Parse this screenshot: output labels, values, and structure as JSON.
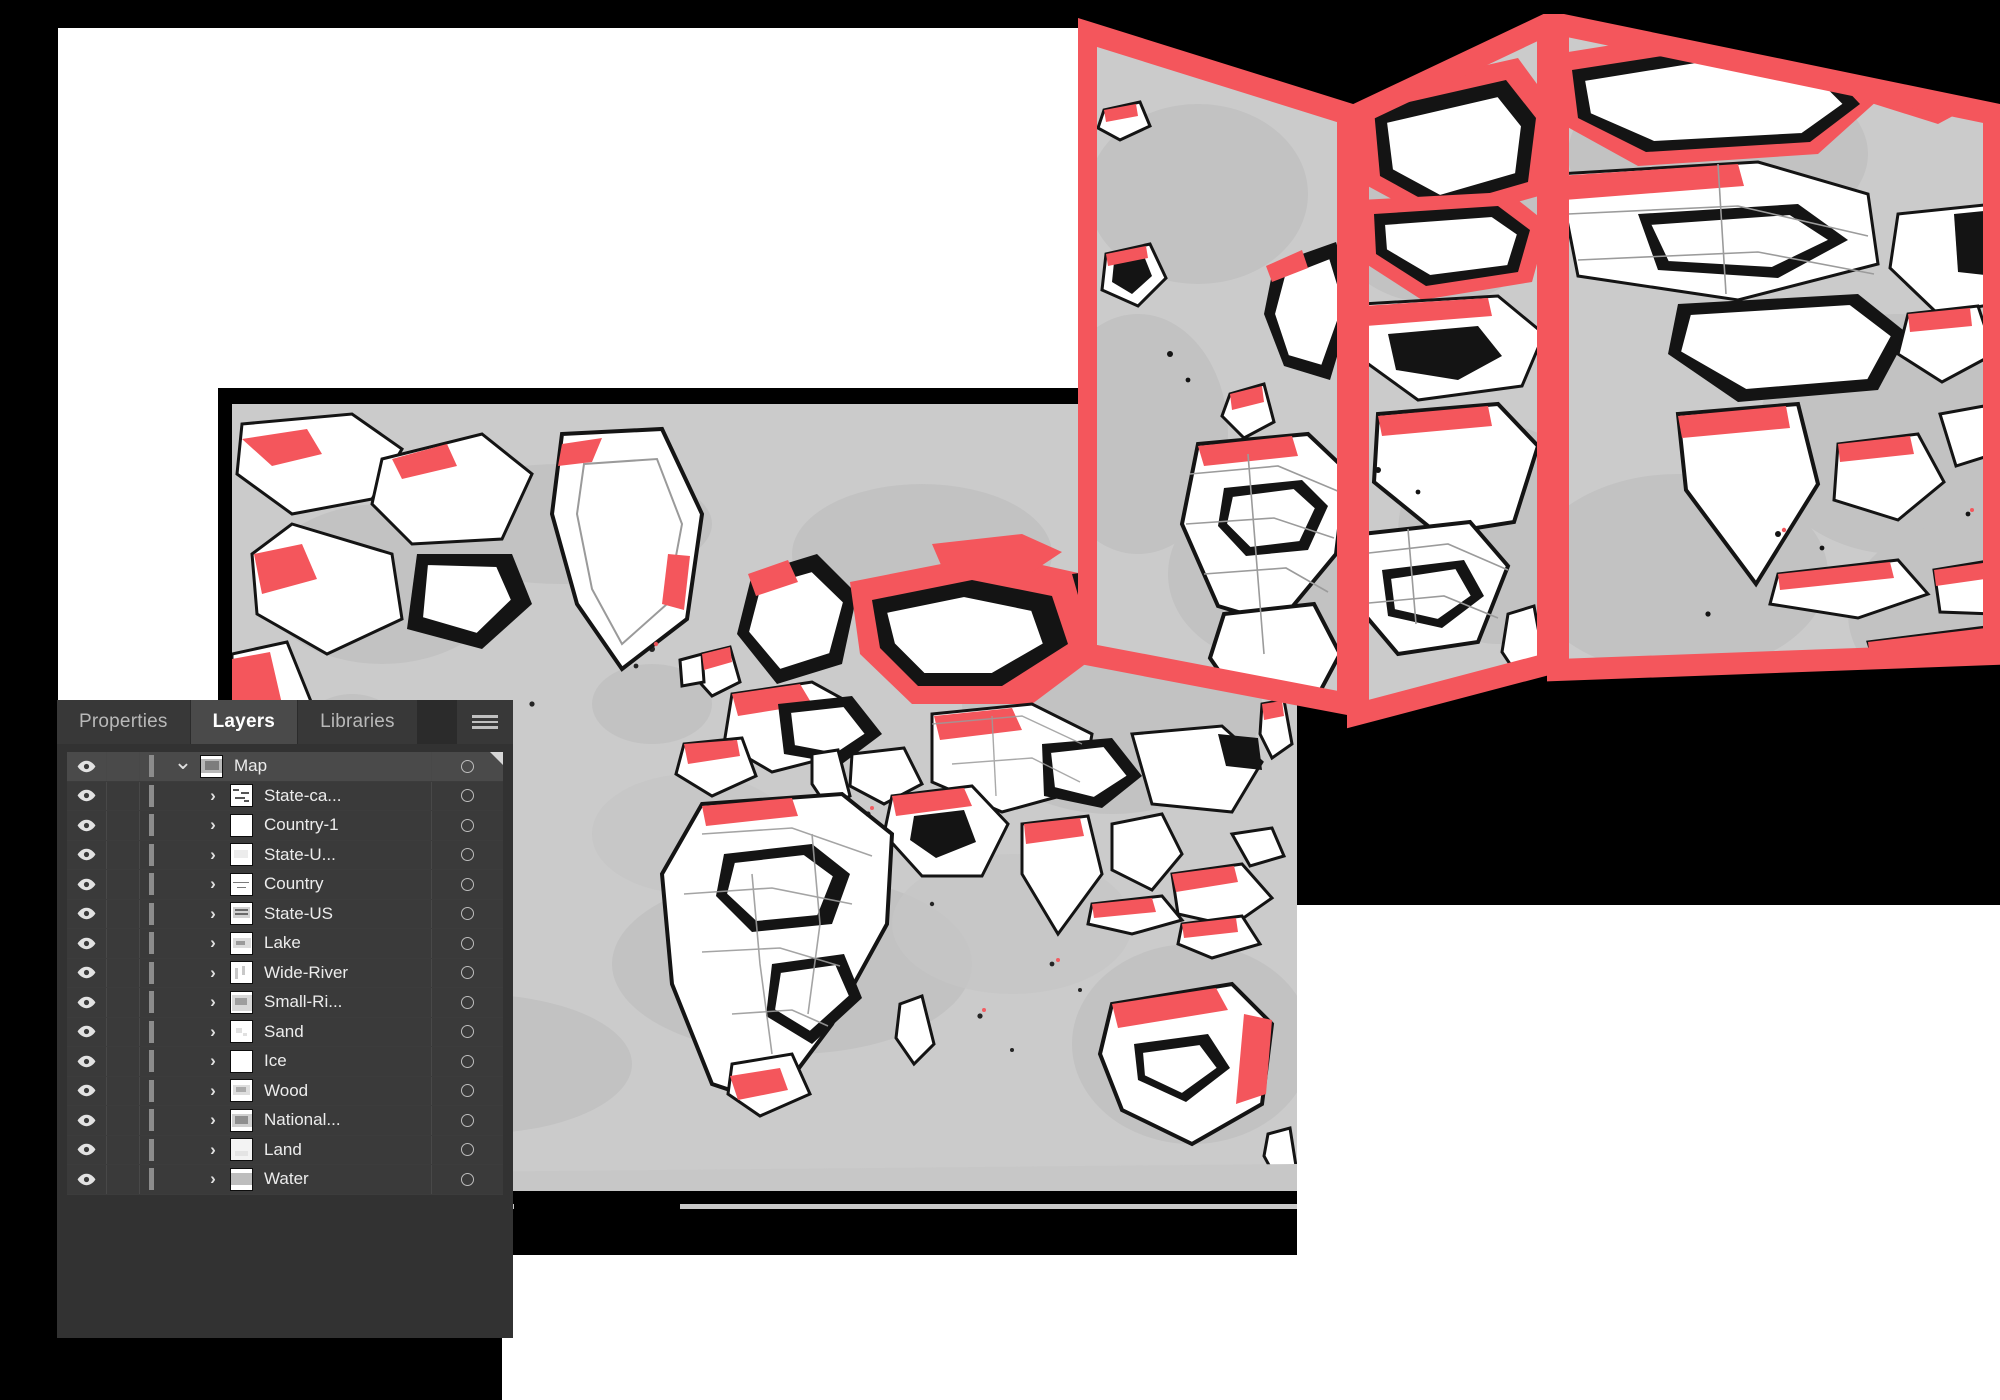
{
  "app": {
    "window_title": "Map",
    "accent_color": "#f4565c",
    "panel_bg": "#323232",
    "row_bg": "#3a3a3a",
    "row_selected_bg": "#4a4a4a",
    "map_ocean_color": "#cbcbcb",
    "map_land_color": "#ffffff",
    "map_outline_color": "#141414"
  },
  "panel": {
    "tabs": [
      {
        "label": "Properties",
        "active": false
      },
      {
        "label": "Layers",
        "active": true
      },
      {
        "label": "Libraries",
        "active": false
      }
    ],
    "menu_icon": "hamburger-menu-icon",
    "layers": [
      {
        "name": "Map",
        "indent": 0,
        "expanded": true,
        "selected": true,
        "visible": true,
        "twisty": "chevron-down-icon",
        "thumb": "world-map-thumb"
      },
      {
        "name": "State-ca...",
        "indent": 1,
        "expanded": false,
        "selected": false,
        "visible": true,
        "twisty": "chevron-right-icon",
        "thumb": "state-capital-thumb"
      },
      {
        "name": "Country-1",
        "indent": 1,
        "expanded": false,
        "selected": false,
        "visible": true,
        "twisty": "chevron-right-icon",
        "thumb": "blank-thumb"
      },
      {
        "name": "State-U...",
        "indent": 1,
        "expanded": false,
        "selected": false,
        "visible": true,
        "twisty": "chevron-right-icon",
        "thumb": "state-us-faint-thumb"
      },
      {
        "name": "Country",
        "indent": 1,
        "expanded": false,
        "selected": false,
        "visible": true,
        "twisty": "chevron-right-icon",
        "thumb": "country-outline-thumb"
      },
      {
        "name": "State-US",
        "indent": 1,
        "expanded": false,
        "selected": false,
        "visible": true,
        "twisty": "chevron-right-icon",
        "thumb": "state-us-thumb"
      },
      {
        "name": "Lake",
        "indent": 1,
        "expanded": false,
        "selected": false,
        "visible": true,
        "twisty": "chevron-right-icon",
        "thumb": "lake-thumb"
      },
      {
        "name": "Wide-River",
        "indent": 1,
        "expanded": false,
        "selected": false,
        "visible": true,
        "twisty": "chevron-right-icon",
        "thumb": "wide-river-thumb"
      },
      {
        "name": "Small-Ri...",
        "indent": 1,
        "expanded": false,
        "selected": false,
        "visible": true,
        "twisty": "chevron-right-icon",
        "thumb": "small-river-thumb"
      },
      {
        "name": "Sand",
        "indent": 1,
        "expanded": false,
        "selected": false,
        "visible": true,
        "twisty": "chevron-right-icon",
        "thumb": "sand-thumb"
      },
      {
        "name": "Ice",
        "indent": 1,
        "expanded": false,
        "selected": false,
        "visible": true,
        "twisty": "chevron-right-icon",
        "thumb": "blank-thumb"
      },
      {
        "name": "Wood",
        "indent": 1,
        "expanded": false,
        "selected": false,
        "visible": true,
        "twisty": "chevron-right-icon",
        "thumb": "wood-thumb"
      },
      {
        "name": "National...",
        "indent": 1,
        "expanded": false,
        "selected": false,
        "visible": true,
        "twisty": "chevron-right-icon",
        "thumb": "national-thumb"
      },
      {
        "name": "Land",
        "indent": 1,
        "expanded": false,
        "selected": false,
        "visible": true,
        "twisty": "chevron-right-icon",
        "thumb": "land-thumb"
      },
      {
        "name": "Water",
        "indent": 1,
        "expanded": false,
        "selected": false,
        "visible": true,
        "twisty": "chevron-right-icon",
        "thumb": "water-thumb"
      }
    ]
  },
  "brochure": {
    "border_color": "#f4565c",
    "panel_count": 3,
    "description": "tri-fold world map brochure"
  }
}
